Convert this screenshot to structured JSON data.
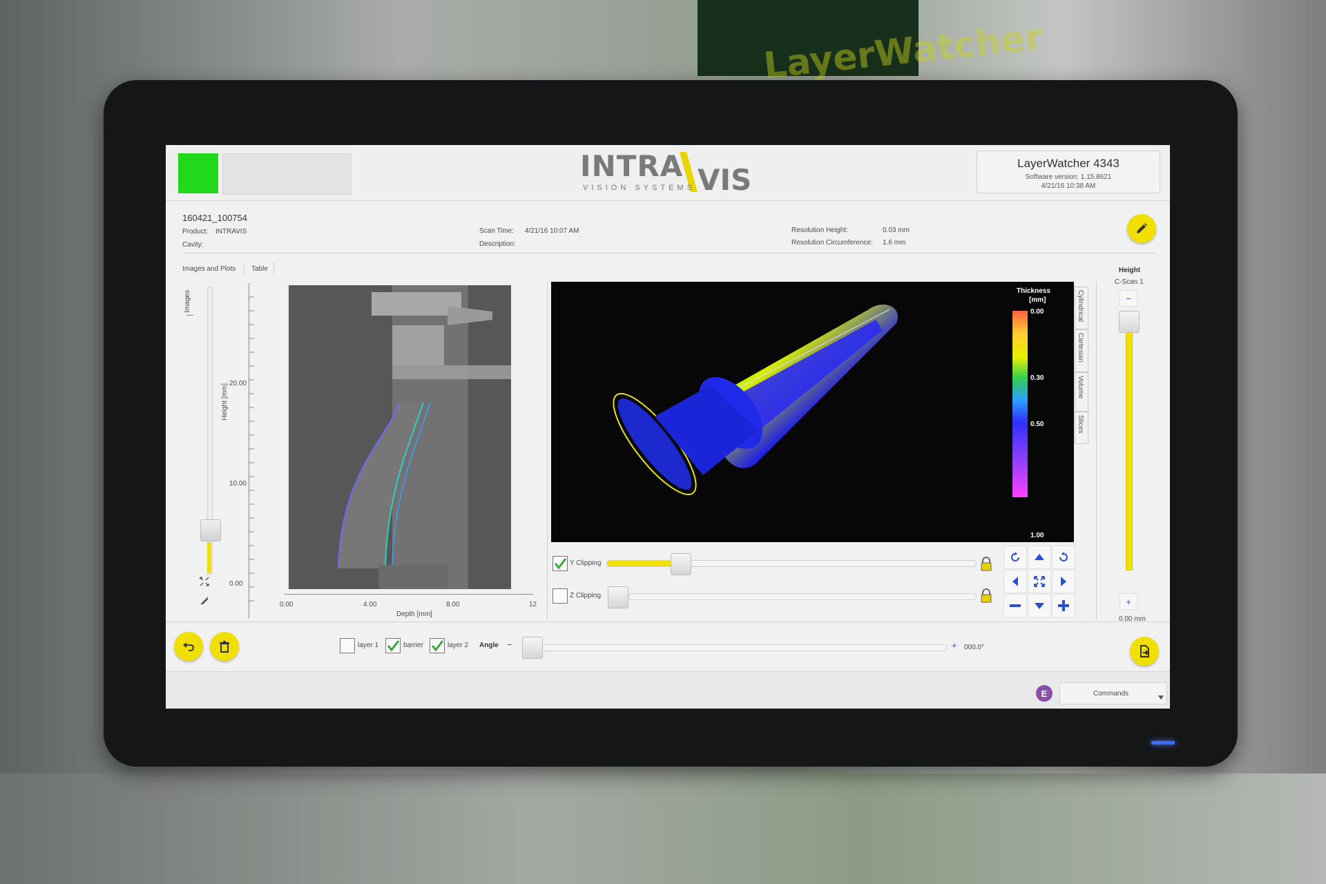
{
  "background": {
    "sign_text": "LayerWatcher"
  },
  "header": {
    "logo_main": "INTRA",
    "logo_vis": "VIS",
    "logo_sub": "VISION SYSTEMS",
    "app_title": "LayerWatcher 4343",
    "software_version": "Software version: 1.15.8621",
    "app_datetime": "4/21/16 10:38 AM",
    "status_color": "#22d81b"
  },
  "info": {
    "scan_id": "160421_100754",
    "product_label": "Product:",
    "product_value": "INTRAVIS",
    "cavity_label": "Cavity:",
    "scan_time_label": "Scan Time:",
    "scan_time_value": "4/21/16 10:07 AM",
    "description_label": "Description:",
    "res_height_label": "Resolution Height:",
    "res_height_value": "0.03 mm",
    "res_circ_label": "Resolution Circumference:",
    "res_circ_value": "1.6 mm"
  },
  "tabs": [
    {
      "label": "Images and Plots"
    },
    {
      "label": "Table"
    }
  ],
  "left_slider": {
    "label": "Images"
  },
  "scan_plot": {
    "ylabel": "Height [mm]",
    "xlabel": "Depth [mm]",
    "y_ticks": [
      "20.00",
      "10.00",
      "0.00"
    ],
    "x_ticks": [
      "0.00",
      "4.00",
      "8.00",
      "12"
    ]
  },
  "view3d": {
    "colorbar_title_line1": "Thickness",
    "colorbar_title_line2": "[mm]",
    "colorbar_ticks": [
      "0.00",
      "0.30",
      "0.50",
      "1.00"
    ],
    "side_tabs": [
      "Cylindrical",
      "Cartesian",
      "Volume",
      "Slices"
    ]
  },
  "clipping": {
    "y_label": "Y Clipping",
    "y_checked": true,
    "y_level": 0.2,
    "z_label": "Z Clipping",
    "z_checked": false,
    "z_level": 0.0
  },
  "height_panel": {
    "title": "Height",
    "subtitle": "C-Scan 1",
    "minus": "−",
    "plus": "+",
    "value": "0.00 mm"
  },
  "bottom_bar": {
    "layers": [
      {
        "label": "layer 1",
        "checked": false
      },
      {
        "label": "barrier",
        "checked": true
      },
      {
        "label": "layer 2",
        "checked": true
      }
    ],
    "angle_label": "Angle",
    "angle_minus": "−",
    "angle_plus": "+",
    "angle_value": "000.0°"
  },
  "footer": {
    "badge": "E",
    "commands_label": "Commands",
    "badge_color": "#8a4fa8"
  },
  "colors": {
    "accent_yellow": "#f1df00",
    "status_green": "#22d81b",
    "control_blue": "#2b4fd0"
  }
}
